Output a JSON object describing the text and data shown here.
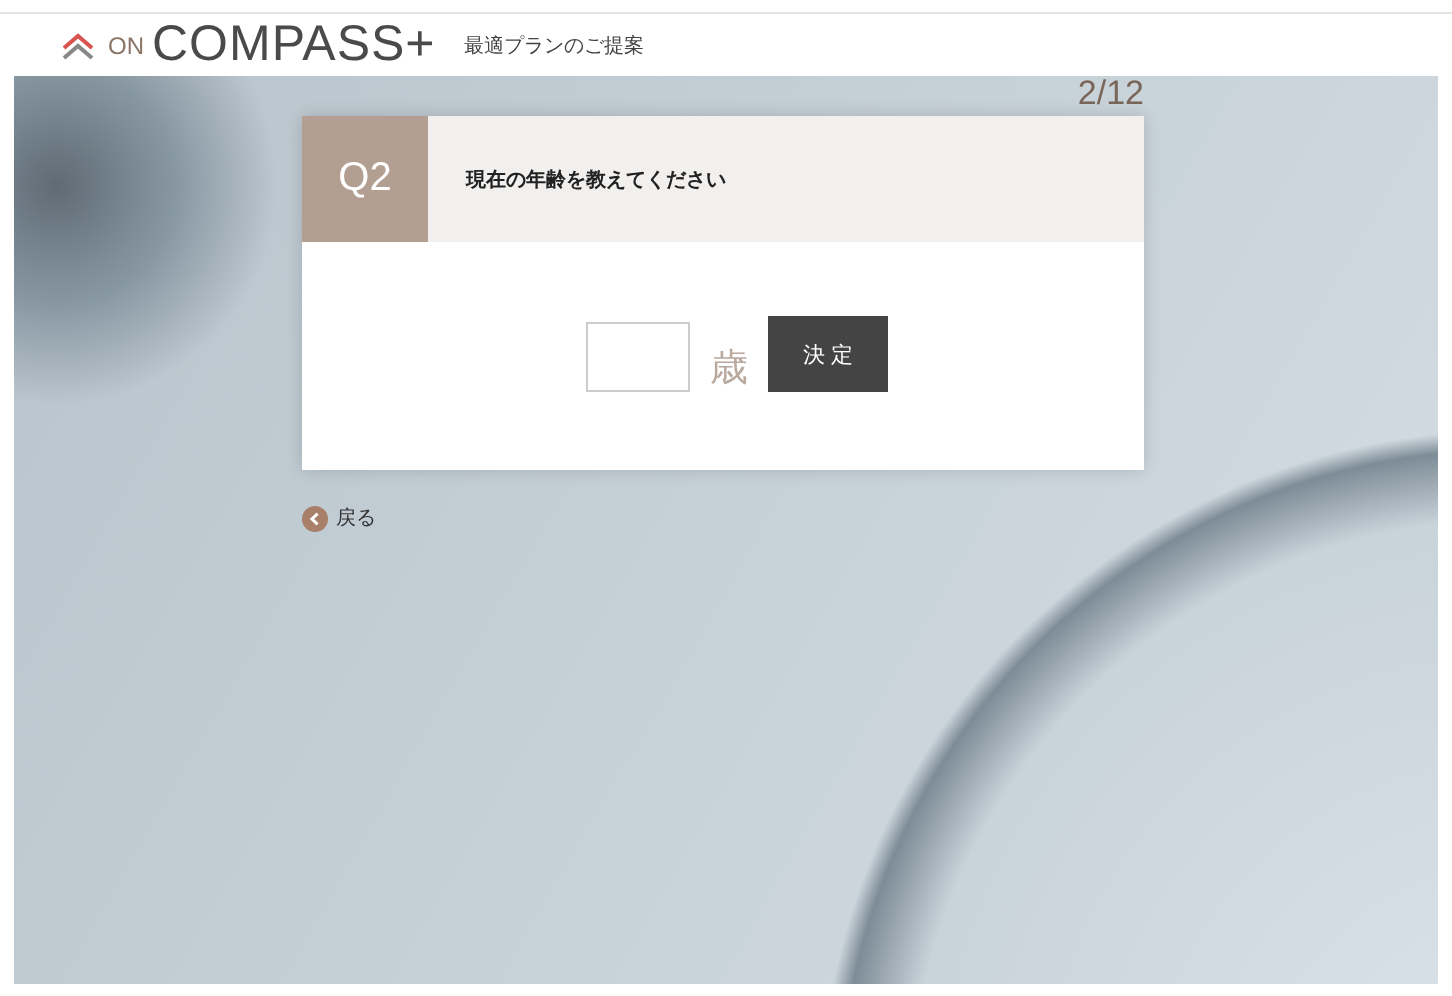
{
  "header": {
    "logo_prefix": "ON",
    "logo_name": "COMPASS+",
    "subtitle": "最適プランのご提案"
  },
  "progress": "2/12",
  "question": {
    "number": "Q2",
    "text": "現在の年齢を教えてください",
    "unit": "歳",
    "submit": "決 定"
  },
  "back_link": "戻る"
}
